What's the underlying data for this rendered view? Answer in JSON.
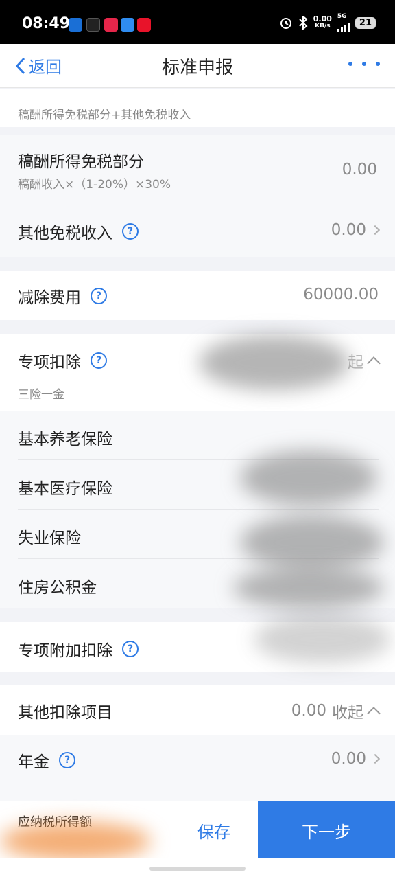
{
  "status_bar": {
    "time": "08:49",
    "net_speed": "0.00",
    "net_unit": "KB/s",
    "network": "5G",
    "battery": "21"
  },
  "nav": {
    "back_label": "返回",
    "title": "标准申报"
  },
  "sections": {
    "partial_sub": "稿酬所得免税部分+其他免税收入",
    "royalty_exempt": {
      "label": "稿酬所得免税部分",
      "sub": "稿酬收入×（1-20%）×30%",
      "value": "0.00"
    },
    "other_exempt": {
      "label": "其他免税收入",
      "value": "0.00"
    },
    "deduction_fee": {
      "label": "减除费用",
      "value": "60000.00"
    },
    "special_deduction": {
      "label": "专项扣除",
      "sub": "三险一金",
      "value_suffix": "起"
    },
    "insurance_items": [
      "基本养老保险",
      "基本医疗保险",
      "失业保险",
      "住房公积金"
    ],
    "special_additional": {
      "label": "专项附加扣除"
    },
    "other_deduction": {
      "label": "其他扣除项目",
      "value": "0.00",
      "toggle": "收起"
    },
    "annuity": {
      "label": "年金",
      "value": "0.00"
    }
  },
  "bottom": {
    "taxable_label": "应纳税所得额",
    "save_label": "保存",
    "next_label": "下一步"
  },
  "colors": {
    "accent": "#2f7be5",
    "background": "#f2f3f7"
  },
  "icons": [
    "download-icon",
    "tiktok-icon",
    "tiktok-lite-icon",
    "feishu-icon",
    "taobao-icon",
    "alarm-icon",
    "bluetooth-icon",
    "help-icon",
    "chevron-right-icon",
    "chevron-up-icon",
    "back-chevron-icon",
    "more-icon"
  ]
}
